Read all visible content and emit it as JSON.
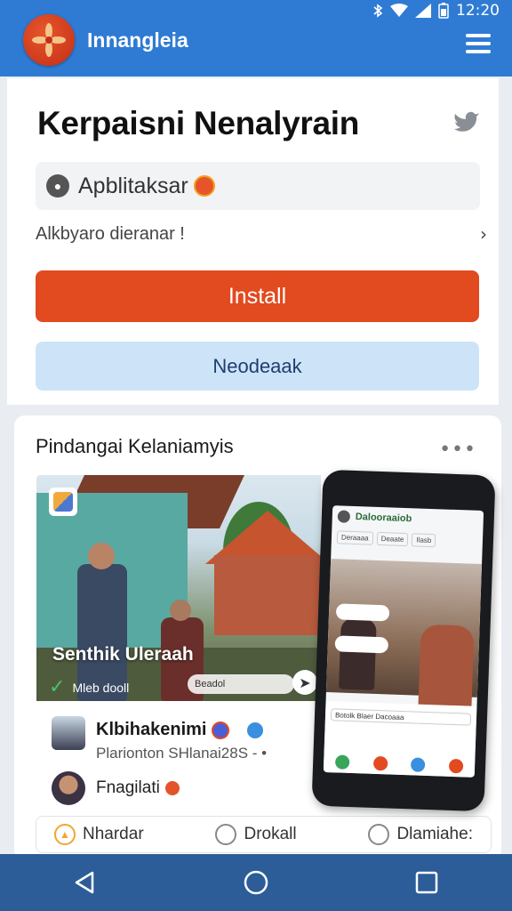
{
  "status_bar": {
    "time": "12:20"
  },
  "app_bar": {
    "title": "Innangleia"
  },
  "hero": {
    "title": "Kerpaisni Nenalyrain",
    "category_label": "Apblitaksar",
    "subtitle": "Alkbyaro dieranar !",
    "install_label": "Install",
    "secondary_label": "Neodeaak"
  },
  "post": {
    "title": "Pindangai Kelaniamyis",
    "more_label": "•••",
    "photo_caption": "Senthik Uleraah",
    "photo_subcaption": "Mleb dooll",
    "photo_input_text": "Beadol",
    "author_name": "Klbihakenimi",
    "author_meta": "Plarionton SHlanai28S - •",
    "commenter_name": "Fnagilati"
  },
  "phone_mockup": {
    "app_name": "Dalooraaiob",
    "chips": [
      "Deraaaa",
      "Deaate",
      "Ilasb"
    ],
    "footer_line": "Botolk Blaer Dacoaaa"
  },
  "reactions": [
    {
      "label": "Nhardar",
      "icon": "thumbs-up-icon"
    },
    {
      "label": "Drokall",
      "icon": "comment-icon"
    },
    {
      "label": "Dlamiahe:",
      "icon": "chat-icon"
    }
  ],
  "colors": {
    "app_bar": "#2f7bd4",
    "install": "#e24a20",
    "secondary": "#cde4f8",
    "bottom_nav": "#2c5d99"
  }
}
